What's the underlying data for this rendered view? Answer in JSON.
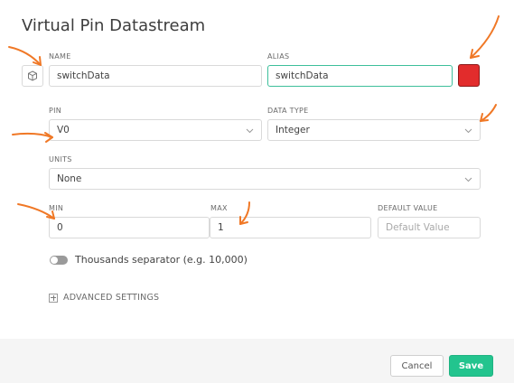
{
  "dialog": {
    "title": "Virtual Pin Datastream"
  },
  "name": {
    "label": "NAME",
    "value": "switchData"
  },
  "alias": {
    "label": "ALIAS",
    "value": "switchData"
  },
  "color": {
    "value": "#e22c2c"
  },
  "pin": {
    "label": "PIN",
    "value": "V0"
  },
  "data_type": {
    "label": "DATA TYPE",
    "value": "Integer"
  },
  "units": {
    "label": "UNITS",
    "value": "None"
  },
  "min": {
    "label": "MIN",
    "value": "0"
  },
  "max": {
    "label": "MAX",
    "value": "1"
  },
  "default_value": {
    "label": "DEFAULT VALUE",
    "placeholder": "Default Value"
  },
  "thousands_separator": {
    "label": "Thousands separator (e.g. 10,000)",
    "enabled": false
  },
  "advanced": {
    "label": "ADVANCED SETTINGS"
  },
  "footer": {
    "cancel_label": "Cancel",
    "save_label": "Save"
  },
  "annotations": {
    "color": "#f07826"
  }
}
